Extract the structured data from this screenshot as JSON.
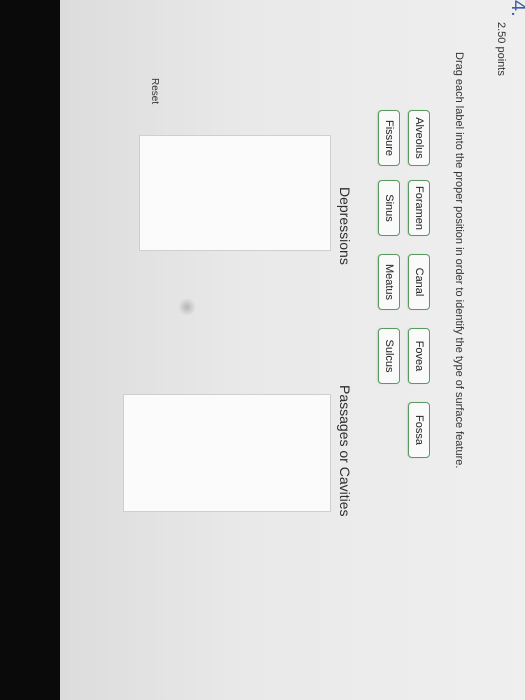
{
  "question": {
    "number": "4.",
    "points": "2.50 points",
    "instruction": "Drag each label into the proper position in order to identify the type of surface feature."
  },
  "labels": [
    {
      "text": "Alveolus"
    },
    {
      "text": "Foramen"
    },
    {
      "text": "Canal"
    },
    {
      "text": "Fovea"
    },
    {
      "text": "Fossa"
    },
    {
      "text": "Fissure"
    },
    {
      "text": "Sinus"
    },
    {
      "text": "Meatus"
    },
    {
      "text": "Sulcus"
    }
  ],
  "categories": [
    {
      "title": "Depressions"
    },
    {
      "title": "Passages or Cavities"
    }
  ],
  "reset_label": "Reset",
  "colors": {
    "label_border": "#5b9a5f",
    "question_number": "#3a5ea8"
  }
}
